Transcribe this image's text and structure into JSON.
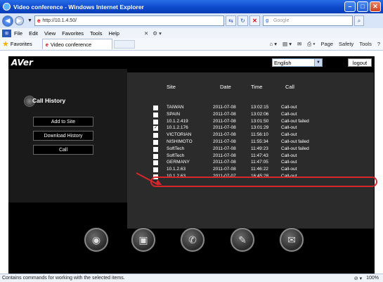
{
  "window": {
    "title": "Video conference - Windows Internet Explorer"
  },
  "address": {
    "url": "http://10.1.4.50/",
    "search_placeholder": "Google"
  },
  "menu": {
    "items": [
      "File",
      "Edit",
      "View",
      "Favorites",
      "Tools",
      "Help"
    ]
  },
  "favorites": {
    "label": "Favorites",
    "tab_title": "Video conference"
  },
  "commands": {
    "page": "Page",
    "safety": "Safety",
    "tools": "Tools"
  },
  "app": {
    "logo": "AVer",
    "language": "English",
    "logout_label": "logout",
    "panel_title": "Call History",
    "buttons": {
      "add_to_site": "Add to Site",
      "download_history": "Download History",
      "call": "Call"
    }
  },
  "table": {
    "headers": {
      "site": "Site",
      "date": "Date",
      "time": "Time",
      "call": "Call"
    },
    "rows": [
      {
        "site": "TAIWAN",
        "date": "2011-07-08",
        "time": "13:02:15",
        "call": "Call-out",
        "checked": false
      },
      {
        "site": "SPAIN",
        "date": "2011-07-08",
        "time": "13:02:06",
        "call": "Call-out",
        "checked": false
      },
      {
        "site": "10.1.2.419",
        "date": "2011-07-08",
        "time": "13:01:50",
        "call": "Call-out failed",
        "checked": false
      },
      {
        "site": "10.1.2.176",
        "date": "2011-07-08",
        "time": "13:01:29",
        "call": "Call-out",
        "checked": true
      },
      {
        "site": "VICTORIAN",
        "date": "2011-07-08",
        "time": "11:56:10",
        "call": "Call-out",
        "checked": false
      },
      {
        "site": "NISHIMOTO",
        "date": "2011-07-08",
        "time": "11:55:34",
        "call": "Call-out failed",
        "checked": false
      },
      {
        "site": "SoftTech",
        "date": "2011-07-08",
        "time": "11:49:23",
        "call": "Call-out failed",
        "checked": false
      },
      {
        "site": "SoftTech",
        "date": "2011-07-08",
        "time": "11:47:43",
        "call": "Call-out",
        "checked": false
      },
      {
        "site": "GERMANY",
        "date": "2011-07-08",
        "time": "11:47:05",
        "call": "Call-out",
        "checked": false
      },
      {
        "site": "10.1.2.63",
        "date": "2011-07-08",
        "time": "11:46:22",
        "call": "Call-out",
        "checked": false
      },
      {
        "site": "10.1.2.63",
        "date": "2011-07-07",
        "time": "16:45:28",
        "call": "Call-out",
        "checked": false
      }
    ]
  },
  "dock": [
    "camera-icon",
    "addressbook-icon",
    "phone-icon",
    "tools-icon",
    "mail-icon"
  ],
  "status": {
    "text": "Contains commands for working with the selected items.",
    "zoom": "100%"
  }
}
